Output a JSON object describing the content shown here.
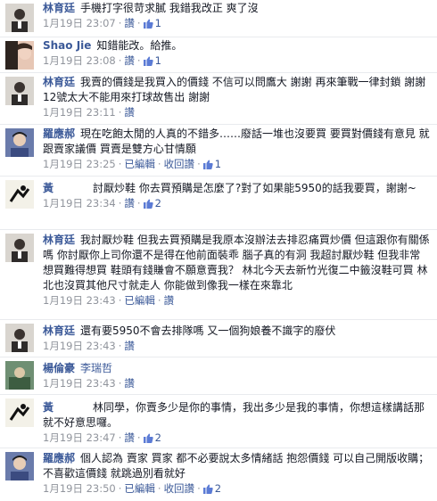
{
  "comments": [
    {
      "name": "林育廷",
      "text": "手機打字很苛求膩 我錯我改正 爽了沒",
      "time": "1月19日 23:07",
      "like": "讚",
      "likes": "1"
    },
    {
      "name": "Shao Jie",
      "text": "知錯能改。給推。",
      "time": "1月19日 23:08",
      "like": "讚",
      "likes": "1"
    },
    {
      "name": "林育廷",
      "text": "我賣的價錢是我買入的價錢 不信可以問鷹大 謝謝 再來筆戰一律封鎖 謝謝 12號太大不能用來打球故售出 謝謝",
      "time": "1月19日 23:11",
      "like": "讚"
    },
    {
      "name": "羅應郝",
      "text": "現在吃飽太閒的人真的不錯多……廢話一堆也沒要買 要買對價錢有意見 就跟賣家議價 買賣是雙方心甘情願",
      "time": "1月19日 23:25",
      "edited": "已編輯",
      "like": "讚",
      "retract": "收回讚",
      "likes": "1"
    },
    {
      "name": "黃",
      "text": "討厭炒鞋 你去買預購是怎麼了?對了如果能5950的話我要買，謝謝~",
      "time": "1月19日 23:34",
      "like": "讚",
      "likes": "2"
    },
    {
      "name": "林育廷",
      "text": "我討厭炒鞋 但我去買預購是我原本沒辦法去排忍痛買炒價 但這跟你有關係嗎 你討厭你上司你還不是得在他前面裝乖 腦子真的有洞 我超討厭炒鞋 但我非常想買難得想買 鞋頭有錢賺會不願意賣我？ 林北今天去新竹光復二中籤沒鞋可買 林北也沒買其他尺寸就走人 你能做到像我一樣在來靠北",
      "time": "1月19日 23:43",
      "edited": "已編輯",
      "like": "讚"
    },
    {
      "name": "林育廷",
      "text": "還有要5950不會去排隊嗎 又一個狗娘養不識字的廢伏",
      "time": "1月19日 23:43",
      "like": "讚"
    },
    {
      "name": "楊倫豪",
      "tag": "李瑞哲",
      "time": "1月19日 23:43",
      "like": "讚"
    },
    {
      "name": "黃",
      "text": "林同學，你賣多少是你的事情，我出多少是我的事情，你想這樣講話那就不好意思囉。",
      "time": "1月19日 23:47",
      "like": "讚",
      "likes": "2"
    },
    {
      "name": "羅應郝",
      "text": "個人認為 賣家 買家 都不必要說太多情緒話 抱怨價錢 可以自己開版收購；不喜歡這價錢 就跳過別看就好",
      "time": "1月19日 23:50",
      "edited": "已編輯",
      "like": "讚",
      "retract": "收回讚",
      "likes": "2"
    }
  ],
  "colors": {
    "link": "#3b5998",
    "meta": "#90949c",
    "text": "#141823",
    "divider": "#e9ebee"
  }
}
